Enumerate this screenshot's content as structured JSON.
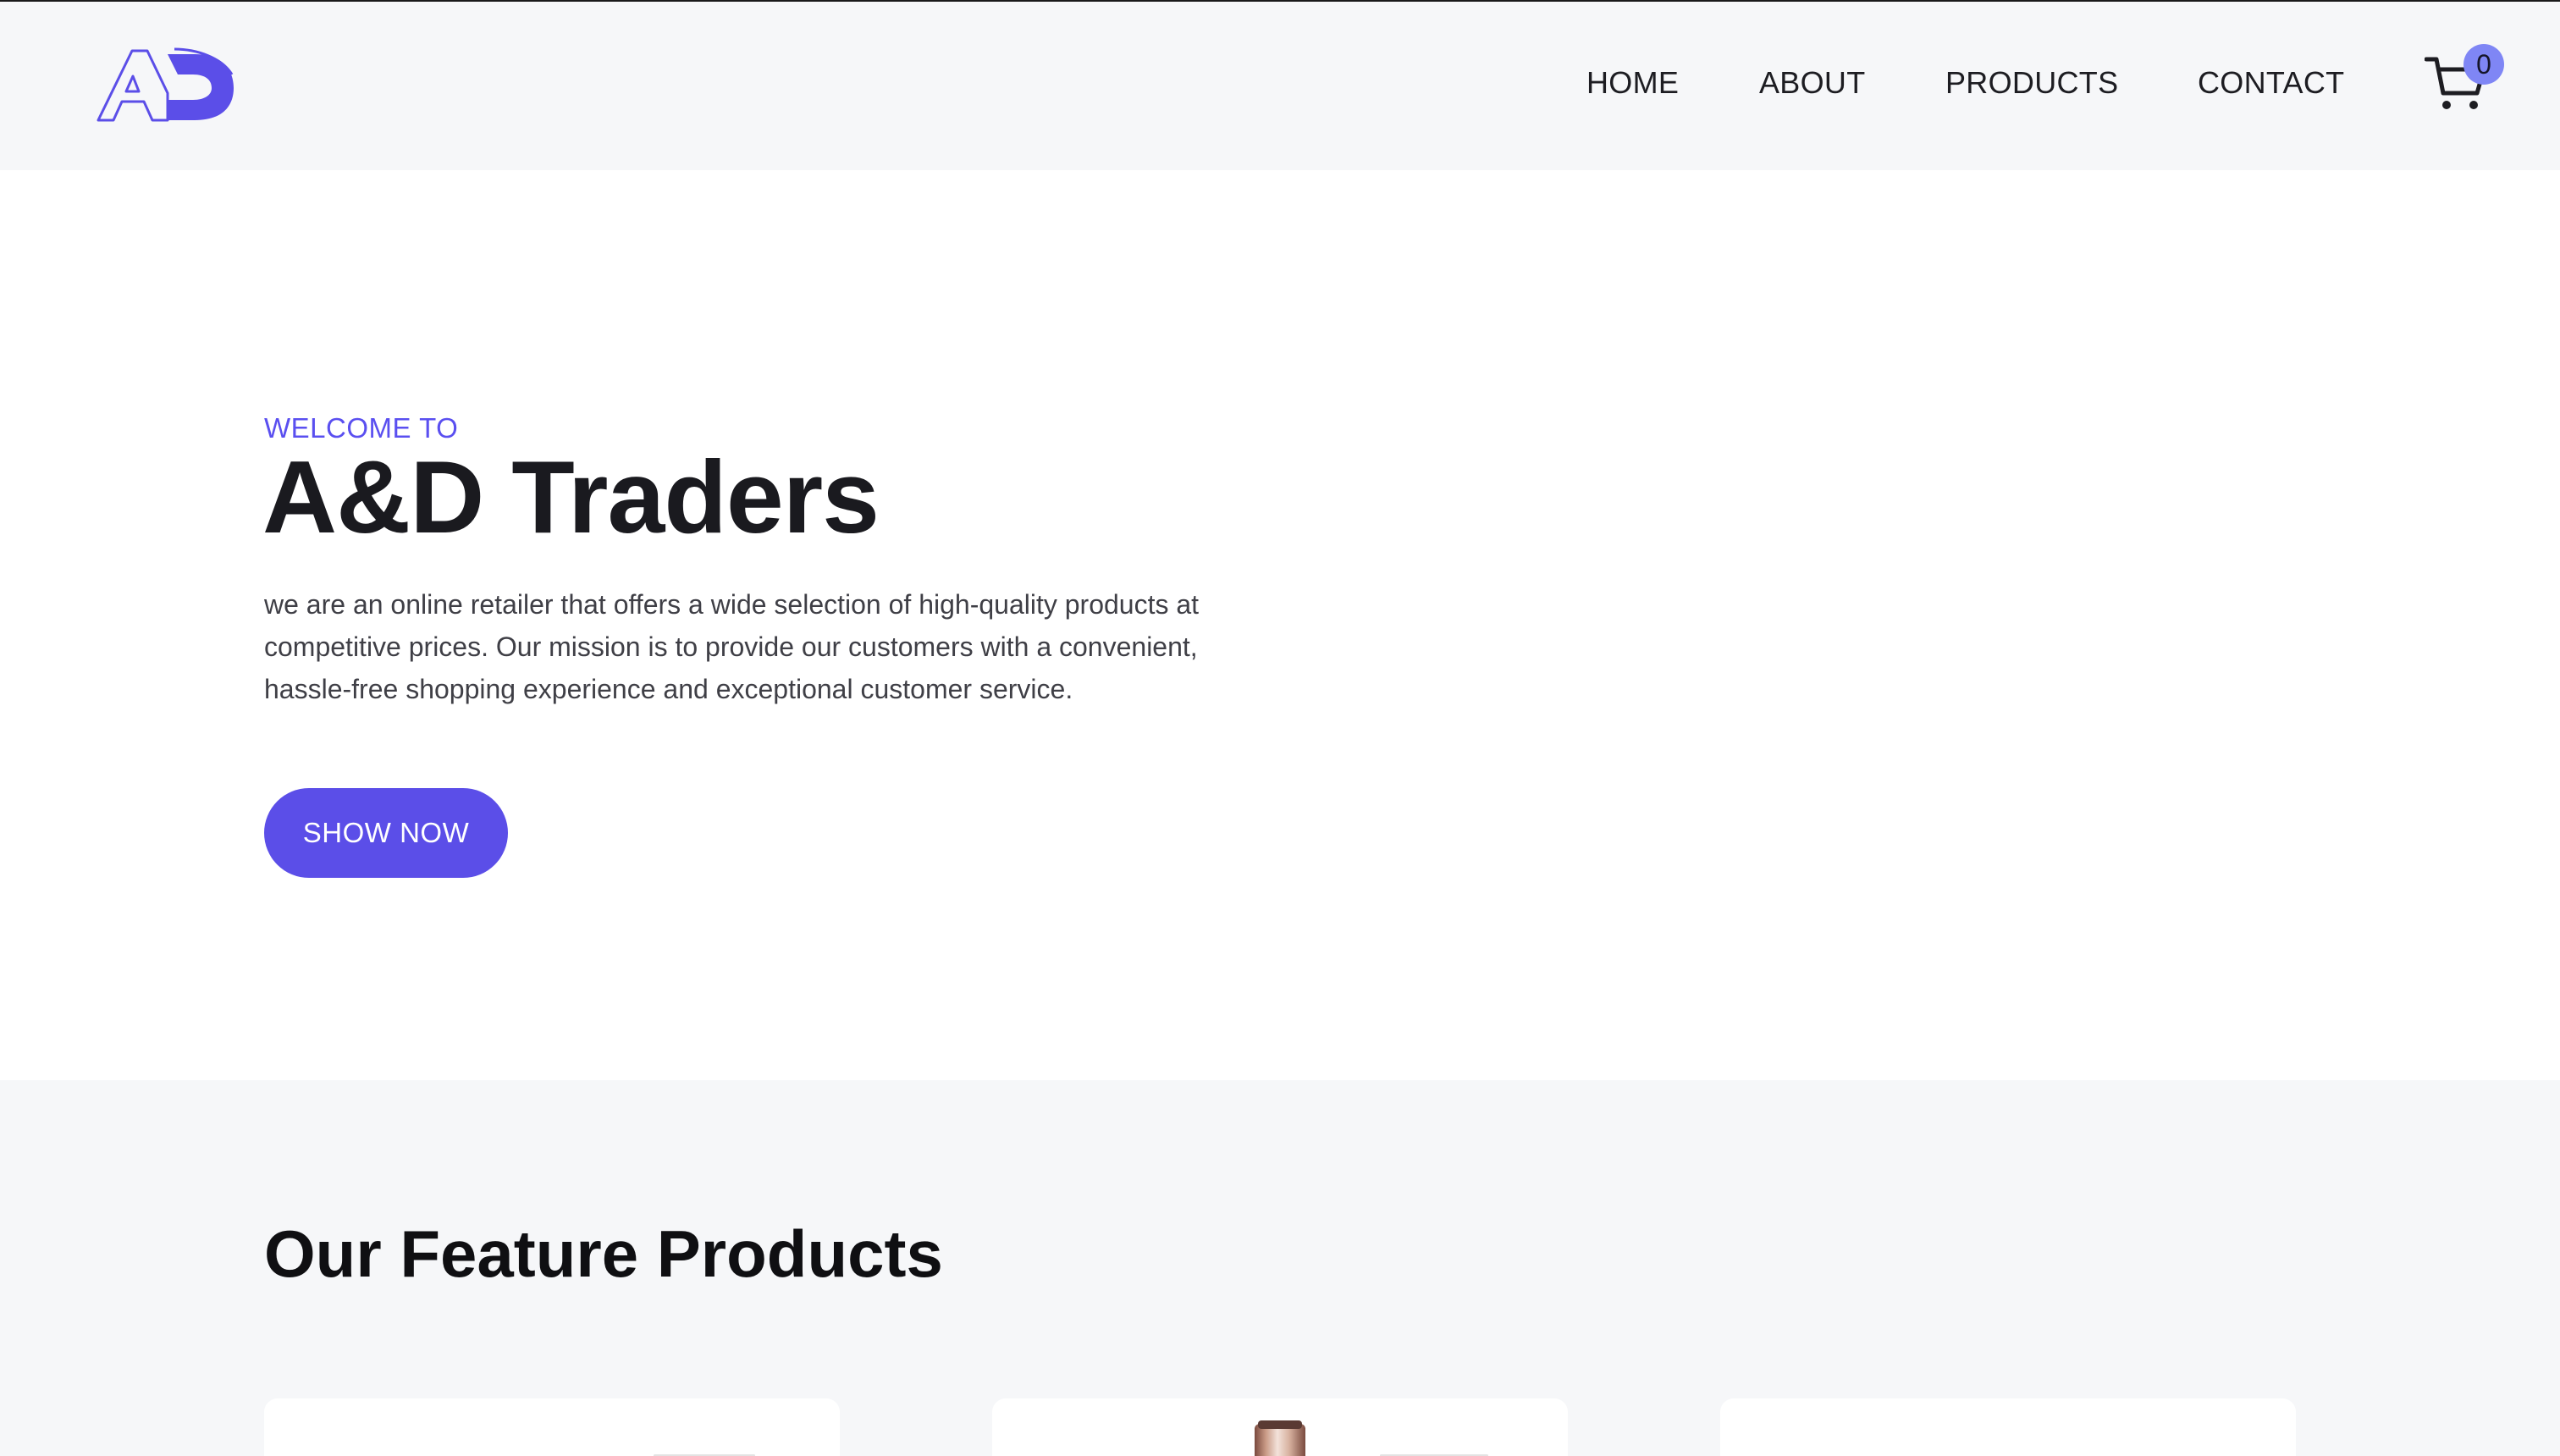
{
  "header": {
    "logo_text": "AD",
    "nav": {
      "home": "HOME",
      "about": "ABOUT",
      "products": "PRODUCTS",
      "contact": "CONTACT"
    },
    "cart": {
      "icon": "cart-icon",
      "count": "0"
    }
  },
  "hero": {
    "eyebrow": "WELCOME TO",
    "title": "A&D Traders",
    "description": "we are an online retailer that offers a wide selection of high-quality products at competitive prices. Our mission is to provide our customers with a convenient, hassle-free shopping experience and exceptional customer service.",
    "cta_label": "SHOW NOW"
  },
  "featured": {
    "title": "Our Feature Products",
    "cards": [
      {
        "image": "product-image"
      },
      {
        "image": "perfume-bottle-image"
      },
      {
        "image": "product-image"
      }
    ]
  },
  "colors": {
    "accent": "#5b4ee8",
    "eyebrow": "#5a4ff0",
    "badge": "#7f86f5",
    "header_bg": "#f6f7f9",
    "section_bg": "#f6f7f9"
  }
}
